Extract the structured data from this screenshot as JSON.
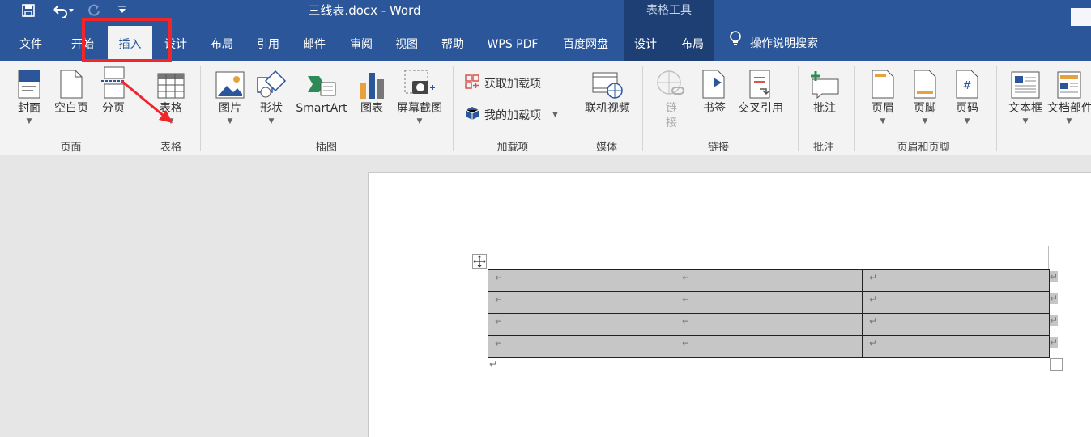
{
  "title_bar": {
    "document_title": "三线表.docx  -  Word",
    "contextual_group": "表格工具"
  },
  "quick_access": {
    "save_icon": "save-icon",
    "undo_icon": "undo-icon",
    "redo_icon": "redo-icon",
    "customize_icon": "customize-qat-icon"
  },
  "tabs": [
    "文件",
    "开始",
    "插入",
    "设计",
    "布局",
    "引用",
    "邮件",
    "审阅",
    "视图",
    "帮助",
    "WPS PDF",
    "百度网盘",
    "设计",
    "布局"
  ],
  "active_tab": "插入",
  "tell_me": "操作说明搜索",
  "ribbon": {
    "pages": {
      "label": "页面",
      "cover": "封面",
      "blank": "空白页",
      "break": "分页"
    },
    "tables": {
      "label": "表格",
      "table": "表格"
    },
    "illustrations": {
      "label": "插图",
      "picture": "图片",
      "shapes": "形状",
      "smartart": "SmartArt",
      "chart": "图表",
      "screenshot": "屏幕截图"
    },
    "addins": {
      "label": "加载项",
      "get": "获取加载项",
      "my": "我的加载项"
    },
    "media": {
      "label": "媒体",
      "video": "联机视频"
    },
    "links": {
      "label": "链接",
      "link_1": "链",
      "link_2": "接",
      "bookmark": "书签",
      "crossref": "交叉引用"
    },
    "comments": {
      "label": "批注",
      "comment": "批注"
    },
    "header_footer": {
      "label": "页眉和页脚",
      "header": "页眉",
      "footer": "页脚",
      "page_number": "页码"
    },
    "text": {
      "textbox": "文本框",
      "quickparts": "文档部件"
    }
  },
  "document": {
    "rows": [
      [
        "↵",
        "↵",
        "↵"
      ],
      [
        "↵",
        "↵",
        "↵"
      ],
      [
        "↵",
        "↵",
        "↵"
      ],
      [
        "↵",
        "↵",
        "↵"
      ]
    ],
    "end_marks": [
      "↵",
      "↵",
      "↵",
      "↵"
    ],
    "after_table_mark": "↵"
  },
  "colors": {
    "brand": "#2b579a",
    "annotation": "#f0262a",
    "table_fill": "#c6c6c6"
  }
}
